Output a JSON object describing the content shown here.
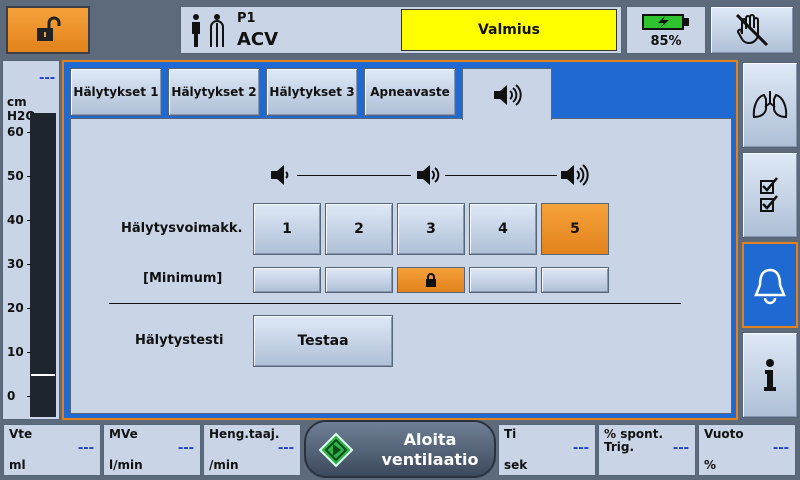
{
  "header": {
    "patient_id": "P1",
    "mode": "ACV",
    "status": "Valmius",
    "battery_percent": "85%",
    "battery_level": 1.0,
    "icons": [
      "unlock-icon",
      "patient-icon",
      "battery-charging-icon",
      "alarm-silence-hand-icon"
    ]
  },
  "pressure": {
    "value": "---",
    "unit": "cm H2O",
    "ticks": [
      "60",
      "50",
      "40",
      "30",
      "20",
      "10",
      "0"
    ],
    "current": 5
  },
  "tabs": [
    {
      "label": "Hälytykset 1"
    },
    {
      "label": "Hälytykset 2"
    },
    {
      "label": "Hälytykset 3"
    },
    {
      "label": "Apneavaste"
    },
    {
      "label": "",
      "icon": "speaker-icon",
      "active": true
    }
  ],
  "alarm_volume": {
    "label": "Hälytysvoimakk.",
    "levels": [
      "1",
      "2",
      "3",
      "4",
      "5"
    ],
    "selected": "5",
    "minimum_label": "[Minimum]",
    "minimum_locked": "3",
    "test_label": "Hälytystesti",
    "test_button": "Testaa"
  },
  "sidebar": [
    "lungs-icon",
    "checklist-icon",
    "alarm-bell-icon",
    "info-icon"
  ],
  "bottom": {
    "vte": {
      "label": "Vte",
      "value": "---",
      "unit": "ml"
    },
    "mve": {
      "label": "MVe",
      "value": "---",
      "unit": "l/min"
    },
    "resp_rate": {
      "label": "Heng.taaj.",
      "value": "---",
      "unit": "/min"
    },
    "start": {
      "label": "Aloita ventilaatio"
    },
    "ti": {
      "label": "Ti",
      "value": "---",
      "unit": "sek"
    },
    "spont": {
      "label": "% spont. Trig.",
      "value": "---",
      "unit": ""
    },
    "leak": {
      "label": "Vuoto",
      "value": "---",
      "unit": "%"
    }
  },
  "colors": {
    "accent": "#e2821a",
    "status": "#ffff00",
    "frame": "#1e6ad2",
    "value": "#1e3fd6"
  }
}
